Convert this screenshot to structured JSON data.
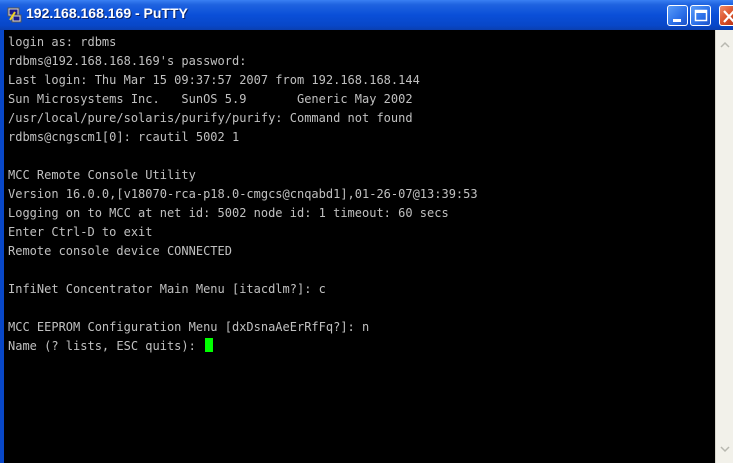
{
  "window": {
    "title": "192.168.168.169 - PuTTY",
    "app_icon": "putty-icon"
  },
  "titlebar_buttons": {
    "minimize_icon": "minimize-icon",
    "maximize_icon": "maximize-icon",
    "close_icon": "close-icon"
  },
  "terminal": {
    "lines": [
      "login as: rdbms",
      "rdbms@192.168.168.169's password:",
      "Last login: Thu Mar 15 09:37:57 2007 from 192.168.168.144",
      "Sun Microsystems Inc.   SunOS 5.9       Generic May 2002",
      "/usr/local/pure/solaris/purify/purify: Command not found",
      "rdbms@cngscm1[0]: rcautil 5002 1",
      "",
      "MCC Remote Console Utility",
      "Version 16.0.0,[v18070-rca-p18.0-cmgcs@cnqabd1],01-26-07@13:39:53",
      "Logging on to MCC at net id: 5002 node id: 1 timeout: 60 secs",
      "Enter Ctrl-D to exit",
      "Remote console device CONNECTED",
      "",
      "InfiNet Concentrator Main Menu [itacdlm?]: c",
      "",
      "MCC EEPROM Configuration Menu [dxDsnaAeErRfFq?]: n",
      "Name (? lists, ESC quits): "
    ],
    "cursor_color": "#00ff00",
    "text_color": "#c0c0c0",
    "background_color": "#000000"
  }
}
